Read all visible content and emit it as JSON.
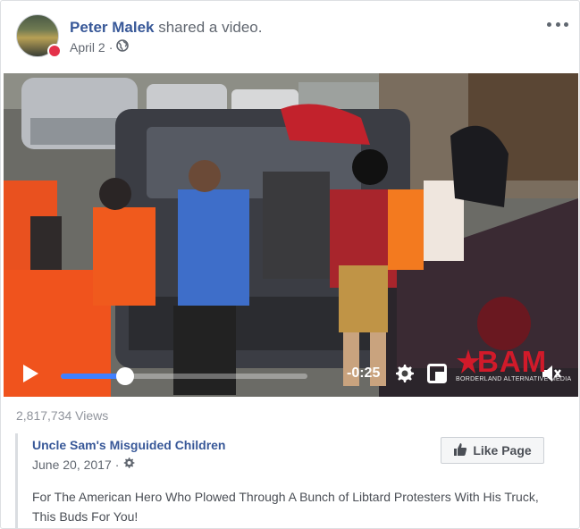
{
  "post": {
    "author_name": "Peter Malek",
    "action_text": " shared a video.",
    "date": "April 2",
    "separator": "·",
    "privacy_icon": "globe-icon",
    "more_icon": "more-options-icon"
  },
  "video": {
    "time_remaining": "-0:25",
    "progress_fraction": 0.26,
    "controls": [
      "play-icon",
      "settings-gear-icon",
      "picture-in-picture-icon",
      "volume-muted-icon"
    ],
    "watermark_title": "BAM",
    "watermark_subtitle": "BORDERLAND ALTERNATIVE MEDIA",
    "accent_color": "#4080ff"
  },
  "views": "2,817,734 Views",
  "shared_page": {
    "name": "Uncle Sam's Misguided Children",
    "date": "June 20, 2017",
    "separator": "·",
    "like_label": "Like Page",
    "text": "For The American Hero Who Plowed Through A Bunch of Libtard Protesters With His Truck, This Buds For You!"
  },
  "colors": {
    "link_blue": "#385898",
    "meta_gray": "#616770",
    "border": "#dddfe2"
  }
}
